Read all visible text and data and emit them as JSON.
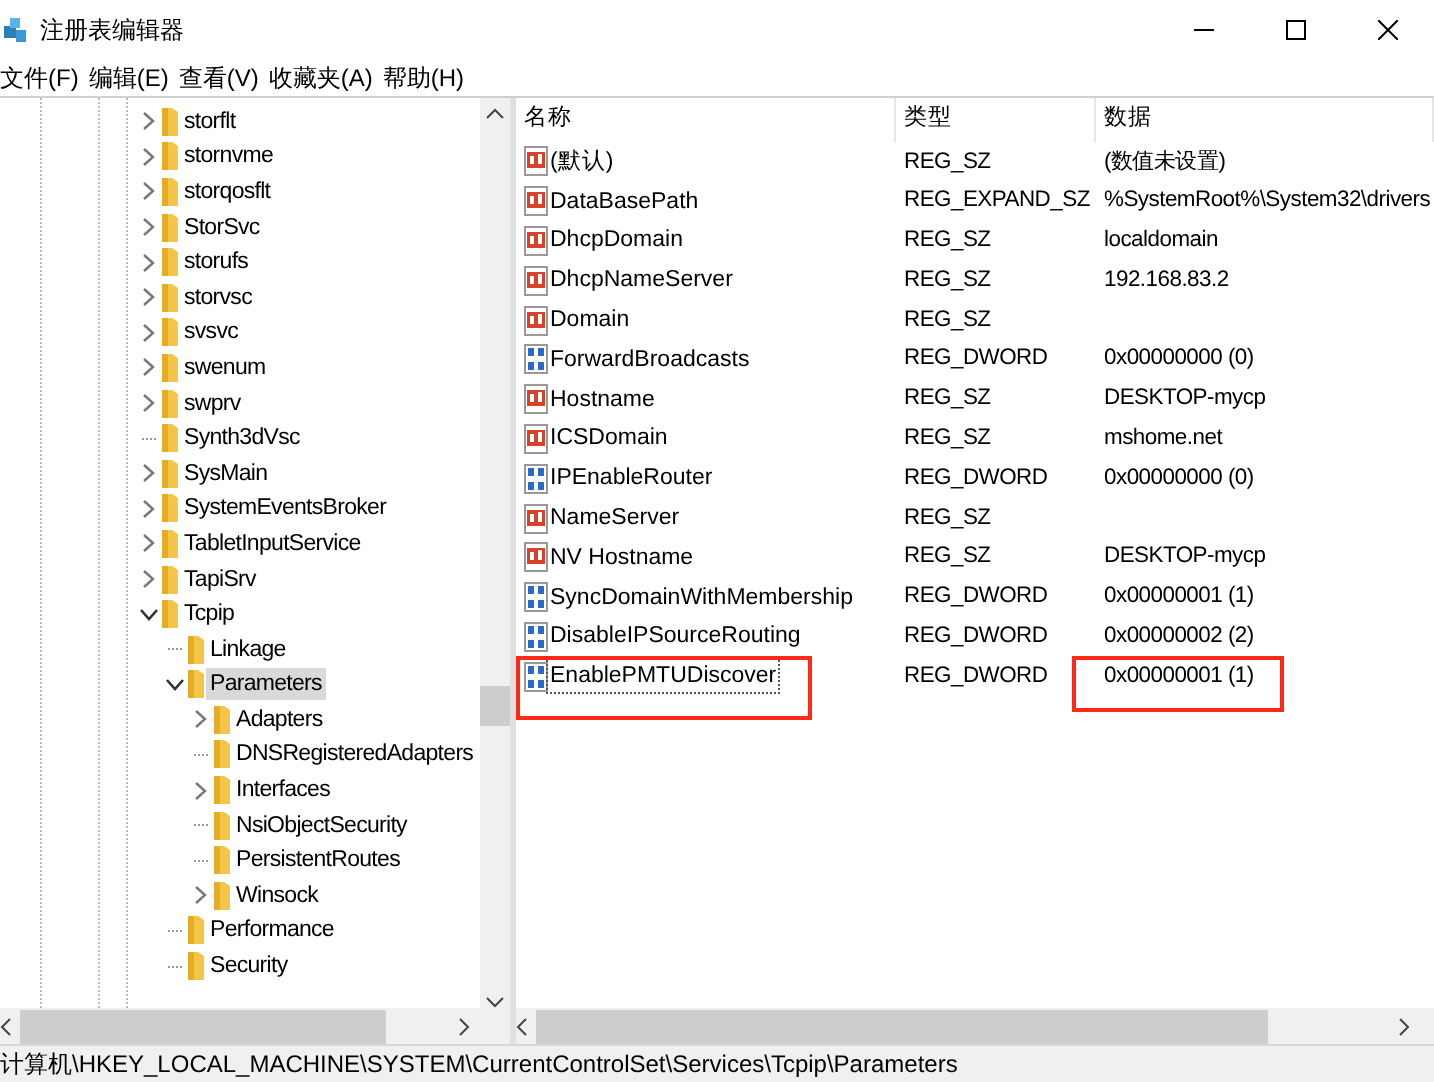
{
  "window": {
    "title": "注册表编辑器"
  },
  "menu": [
    "文件(F)",
    "编辑(E)",
    "查看(V)",
    "收藏夹(A)",
    "帮助(H)"
  ],
  "tree": [
    {
      "label": "storflt",
      "has_subkeys": true,
      "expanded": false,
      "selected": false
    },
    {
      "label": "stornvme",
      "has_subkeys": true,
      "expanded": false,
      "selected": false
    },
    {
      "label": "storqosflt",
      "has_subkeys": true,
      "expanded": false,
      "selected": false
    },
    {
      "label": "StorSvc",
      "has_subkeys": true,
      "expanded": false,
      "selected": false
    },
    {
      "label": "storufs",
      "has_subkeys": true,
      "expanded": false,
      "selected": false
    },
    {
      "label": "storvsc",
      "has_subkeys": true,
      "expanded": false,
      "selected": false
    },
    {
      "label": "svsvc",
      "has_subkeys": true,
      "expanded": false,
      "selected": false
    },
    {
      "label": "swenum",
      "has_subkeys": true,
      "expanded": false,
      "selected": false
    },
    {
      "label": "swprv",
      "has_subkeys": true,
      "expanded": false,
      "selected": false
    },
    {
      "label": "Synth3dVsc",
      "has_subkeys": false,
      "expanded": false,
      "selected": false
    },
    {
      "label": "SysMain",
      "has_subkeys": true,
      "expanded": false,
      "selected": false
    },
    {
      "label": "SystemEventsBroker",
      "has_subkeys": true,
      "expanded": false,
      "selected": false
    },
    {
      "label": "TabletInputService",
      "has_subkeys": true,
      "expanded": false,
      "selected": false
    },
    {
      "label": "TapiSrv",
      "has_subkeys": true,
      "expanded": false,
      "selected": false
    },
    {
      "label": "Tcpip",
      "has_subkeys": true,
      "expanded": true,
      "selected": false,
      "children": [
        {
          "label": "Linkage",
          "has_subkeys": false,
          "expanded": false,
          "selected": false
        },
        {
          "label": "Parameters",
          "has_subkeys": true,
          "expanded": true,
          "selected": true,
          "children": [
            {
              "label": "Adapters",
              "has_subkeys": true,
              "expanded": false,
              "selected": false
            },
            {
              "label": "DNSRegisteredAdapters",
              "has_subkeys": false,
              "expanded": false,
              "selected": false
            },
            {
              "label": "Interfaces",
              "has_subkeys": true,
              "expanded": false,
              "selected": false
            },
            {
              "label": "NsiObjectSecurity",
              "has_subkeys": false,
              "expanded": false,
              "selected": false
            },
            {
              "label": "PersistentRoutes",
              "has_subkeys": false,
              "expanded": false,
              "selected": false
            },
            {
              "label": "Winsock",
              "has_subkeys": true,
              "expanded": false,
              "selected": false
            }
          ]
        },
        {
          "label": "Performance",
          "has_subkeys": false,
          "expanded": false,
          "selected": false
        },
        {
          "label": "Security",
          "has_subkeys": false,
          "expanded": false,
          "selected": false
        }
      ]
    }
  ],
  "table": {
    "columns": [
      "名称",
      "类型",
      "数据"
    ],
    "rows": [
      {
        "kind": "string",
        "name": "(默认)",
        "type": "REG_SZ",
        "data": "(数值未设置)",
        "focused": false,
        "name_boxed": false,
        "data_boxed": false
      },
      {
        "kind": "string",
        "name": "DataBasePath",
        "type": "REG_EXPAND_SZ",
        "data": "%SystemRoot%\\System32\\drivers",
        "focused": false,
        "name_boxed": false,
        "data_boxed": false
      },
      {
        "kind": "string",
        "name": "DhcpDomain",
        "type": "REG_SZ",
        "data": "localdomain",
        "focused": false,
        "name_boxed": false,
        "data_boxed": false
      },
      {
        "kind": "string",
        "name": "DhcpNameServer",
        "type": "REG_SZ",
        "data": "192.168.83.2",
        "focused": false,
        "name_boxed": false,
        "data_boxed": false
      },
      {
        "kind": "string",
        "name": "Domain",
        "type": "REG_SZ",
        "data": "",
        "focused": false,
        "name_boxed": false,
        "data_boxed": false
      },
      {
        "kind": "dword",
        "name": "ForwardBroadcasts",
        "type": "REG_DWORD",
        "data": "0x00000000 (0)",
        "focused": false,
        "name_boxed": false,
        "data_boxed": false
      },
      {
        "kind": "string",
        "name": "Hostname",
        "type": "REG_SZ",
        "data": "DESKTOP-mycp",
        "focused": false,
        "name_boxed": false,
        "data_boxed": false
      },
      {
        "kind": "string",
        "name": "ICSDomain",
        "type": "REG_SZ",
        "data": "mshome.net",
        "focused": false,
        "name_boxed": false,
        "data_boxed": false
      },
      {
        "kind": "dword",
        "name": "IPEnableRouter",
        "type": "REG_DWORD",
        "data": "0x00000000 (0)",
        "focused": false,
        "name_boxed": false,
        "data_boxed": false
      },
      {
        "kind": "string",
        "name": "NameServer",
        "type": "REG_SZ",
        "data": "",
        "focused": false,
        "name_boxed": false,
        "data_boxed": false
      },
      {
        "kind": "string",
        "name": "NV Hostname",
        "type": "REG_SZ",
        "data": "DESKTOP-mycp",
        "focused": false,
        "name_boxed": false,
        "data_boxed": false
      },
      {
        "kind": "dword",
        "name": "SyncDomainWithMembership",
        "type": "REG_DWORD",
        "data": "0x00000001 (1)",
        "focused": false,
        "name_boxed": false,
        "data_boxed": false
      },
      {
        "kind": "dword",
        "name": "DisableIPSourceRouting",
        "type": "REG_DWORD",
        "data": "0x00000002 (2)",
        "focused": false,
        "name_boxed": false,
        "data_boxed": false
      },
      {
        "kind": "dword",
        "name": "EnablePMTUDiscover",
        "type": "REG_DWORD",
        "data": "0x00000001 (1)",
        "focused": true,
        "name_boxed": true,
        "data_boxed": true
      }
    ]
  },
  "status_bar": "计算机\\HKEY_LOCAL_MACHINE\\SYSTEM\\CurrentControlSet\\Services\\Tcpip\\Parameters"
}
